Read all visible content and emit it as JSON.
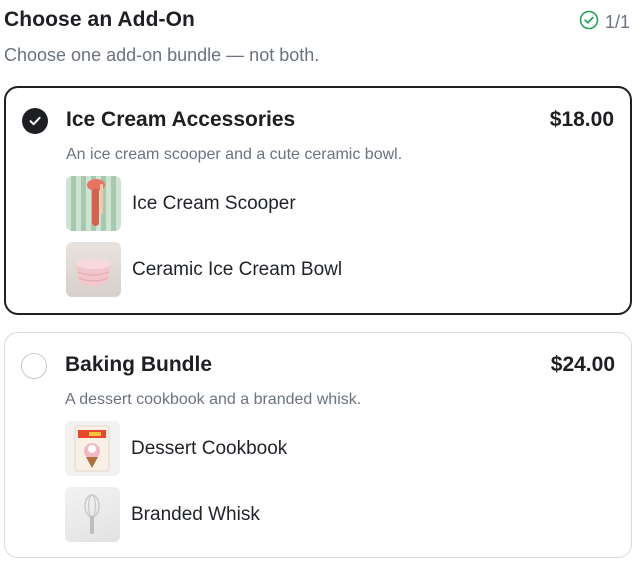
{
  "header": {
    "title": "Choose an Add-On",
    "counter": "1/1",
    "subtitle": "Choose one add-on bundle — not both."
  },
  "options": [
    {
      "name": "Ice Cream Accessories",
      "price": "$18.00",
      "description": "An ice cream scooper and a cute ceramic bowl.",
      "selected": true,
      "items": [
        {
          "label": "Ice Cream Scooper",
          "icon": "scooper-thumbnail"
        },
        {
          "label": "Ceramic Ice Cream Bowl",
          "icon": "bowl-thumbnail"
        }
      ]
    },
    {
      "name": "Baking Bundle",
      "price": "$24.00",
      "description": "A dessert cookbook and a branded whisk.",
      "selected": false,
      "items": [
        {
          "label": "Dessert Cookbook",
          "icon": "cookbook-thumbnail"
        },
        {
          "label": "Branded Whisk",
          "icon": "whisk-thumbnail"
        }
      ]
    }
  ],
  "colors": {
    "selected_border": "#1d1f23",
    "unselected_border": "#d8dadf",
    "counter_check": "#22a35a",
    "muted_text": "#6b7280"
  }
}
